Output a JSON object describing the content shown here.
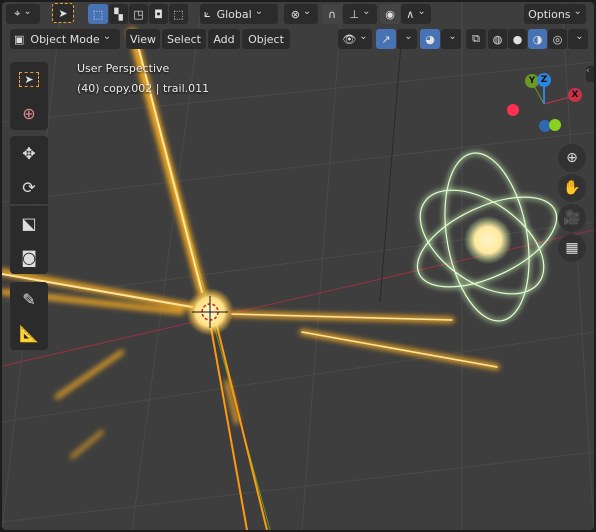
{
  "header": {
    "transform_orientation": "Global",
    "options_label": "Options",
    "mode": "Object Mode",
    "menus": [
      "View",
      "Select",
      "Add",
      "Object"
    ]
  },
  "overlay": {
    "view_name": "User Perspective",
    "object_info": "(40) copy.002 | trail.011"
  },
  "gizmo": {
    "x_label": "X",
    "y_label": "Y",
    "z_label": "Z",
    "x_color": "#c8334a",
    "y_color": "#6a9a25",
    "z_color": "#2f83e0"
  },
  "tools": [
    "select-box",
    "cursor",
    "move",
    "rotate",
    "scale",
    "transform",
    "annotate",
    "measure"
  ],
  "nav_buttons": [
    "zoom",
    "pan",
    "camera",
    "perspective-toggle"
  ],
  "colors": {
    "accent": "#4772b3",
    "viewport": "#3e3e3e",
    "glow_orange": "#ffb020",
    "glow_green": "#b8f0a8"
  }
}
